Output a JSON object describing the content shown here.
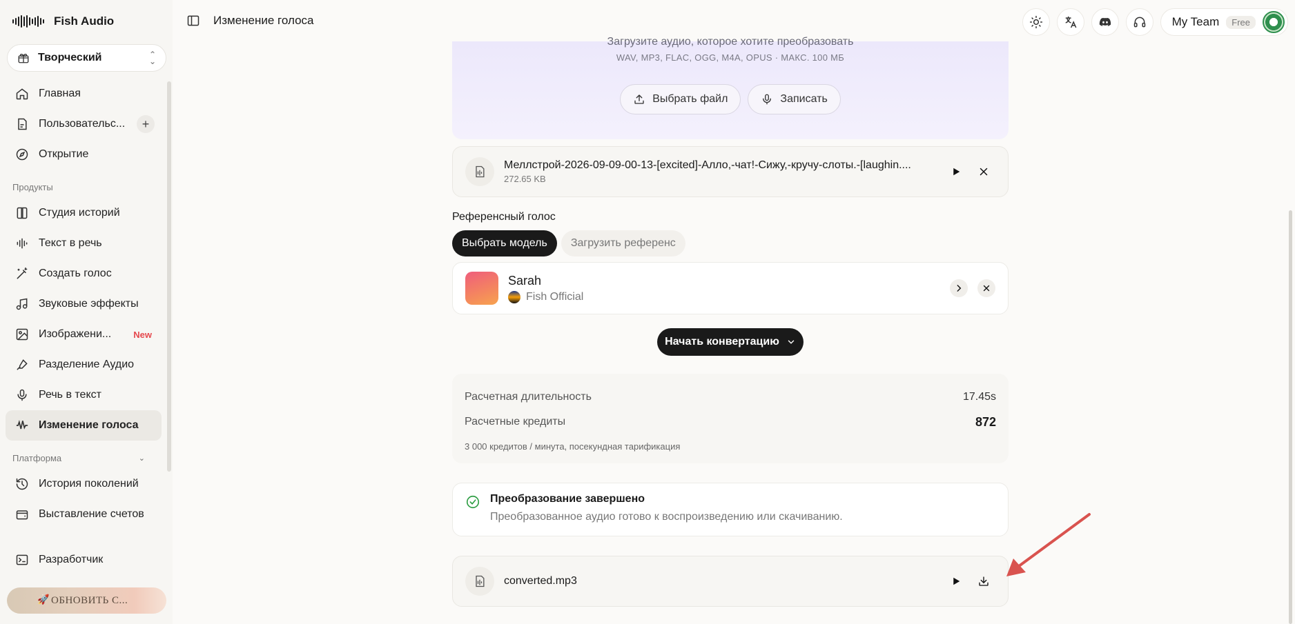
{
  "brand": {
    "name": "Fish Audio"
  },
  "workspace": {
    "label": "Творческий"
  },
  "nav": {
    "items_main": [
      {
        "label": "Главная",
        "icon": "home-icon"
      },
      {
        "label": "Пользовательс...",
        "icon": "document-icon"
      },
      {
        "label": "Открытие",
        "icon": "compass-icon"
      }
    ],
    "section_products": "Продукты",
    "items_products": [
      {
        "label": "Студия историй",
        "icon": "book-icon"
      },
      {
        "label": "Текст в речь",
        "icon": "waveform-icon"
      },
      {
        "label": "Создать голос",
        "icon": "magic-wand-icon"
      },
      {
        "label": "Звуковые эффекты",
        "icon": "music-note-icon"
      },
      {
        "label": "Изображени...",
        "icon": "image-icon",
        "badge": "New"
      },
      {
        "label": "Разделение Аудио",
        "icon": "split-icon"
      },
      {
        "label": "Речь в текст",
        "icon": "microphone-icon"
      },
      {
        "label": "Изменение голоса",
        "icon": "voice-change-icon",
        "active": true
      }
    ],
    "section_platform": "Платформа",
    "items_platform": [
      {
        "label": "История поколений",
        "icon": "history-icon"
      },
      {
        "label": "Выставление счетов",
        "icon": "wallet-icon"
      },
      {
        "label": "Разработчик",
        "icon": "terminal-icon"
      }
    ],
    "upgrade_label": "ОБНОВИТЬ С..."
  },
  "topbar": {
    "title": "Изменение голоса",
    "team": "My Team",
    "plan": "Free"
  },
  "upload": {
    "title": "Загрузите аудио, которое хотите преобразовать",
    "formats": "WAV, MP3, FLAC, OGG, M4A, OPUS · МАКС. 100 МБ",
    "choose_file": "Выбрать файл",
    "record": "Записать"
  },
  "source_file": {
    "name": "Меллстрой-2026-09-09-00-13-[excited]-Алло,-чат!-Сижу,-кручу-слоты.-[laughin....",
    "size": "272.65 KB"
  },
  "reference": {
    "label": "Референсный голос",
    "tab_model": "Выбрать модель",
    "tab_upload": "Загрузить референс",
    "voice_name": "Sarah",
    "voice_owner": "Fish Official"
  },
  "start_button": "Начать конвертацию",
  "stats": {
    "duration_label": "Расчетная длительность",
    "duration_value": "17.45s",
    "credits_label": "Расчетные кредиты",
    "credits_value": "872",
    "note": "3 000 кредитов / минута, посекундная тарификация"
  },
  "status": {
    "title": "Преобразование завершено",
    "subtitle": "Преобразованное аудио готово к воспроизведению или скачиванию."
  },
  "result_file": {
    "name": "converted.mp3"
  },
  "colors": {
    "accent_dark": "#1a1a1a",
    "success": "#2f9e44",
    "new_badge": "#e5484d",
    "annotation_arrow": "#d9534f"
  }
}
